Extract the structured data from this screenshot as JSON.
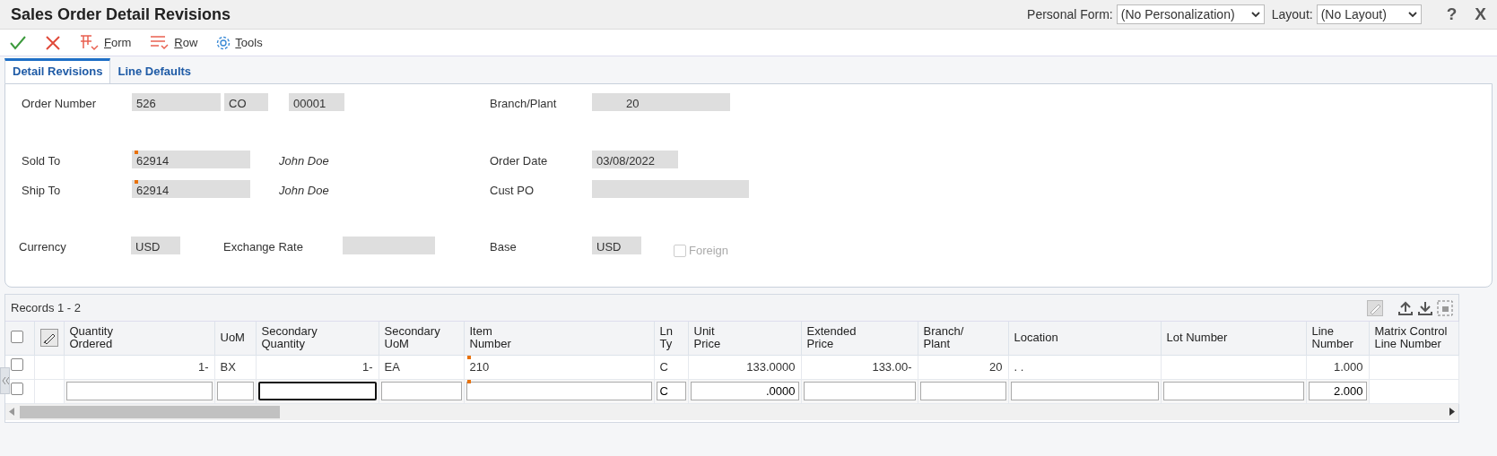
{
  "window": {
    "title": "Sales Order Detail Revisions"
  },
  "header_controls": {
    "personal_form": {
      "label": "Personal Form:",
      "value": "(No Personalization)"
    },
    "layout": {
      "label": "Layout:",
      "value": "(No Layout)"
    },
    "help": "?",
    "close": "X"
  },
  "toolbar": [
    {
      "kind": "ok"
    },
    {
      "kind": "cancel"
    },
    {
      "kind": "form",
      "label": "Form"
    },
    {
      "kind": "row",
      "label": "Row"
    },
    {
      "kind": "tools",
      "label": "Tools"
    }
  ],
  "tabs": [
    {
      "label": "Detail Revisions",
      "selected": true
    },
    {
      "label": "Line Defaults",
      "selected": false
    }
  ],
  "form": {
    "fields": [
      {
        "kind": "field",
        "label": "Order Number",
        "values": [
          "526",
          "CO",
          "00001"
        ]
      },
      {
        "kind": "field",
        "label": "Branch/Plant",
        "values": [
          "20"
        ]
      },
      {
        "kind": "field",
        "label": "Sold To",
        "values": [
          "62914"
        ],
        "required": true,
        "name": "John Doe"
      },
      {
        "kind": "field",
        "label": "Order Date",
        "values": [
          "03/08/2022"
        ]
      },
      {
        "kind": "field",
        "label": "Ship To",
        "values": [
          "62914"
        ],
        "required": true,
        "name": "John Doe"
      },
      {
        "kind": "field",
        "label": "Cust PO"
      },
      {
        "kind": "field",
        "label": "Currency",
        "values": [
          "USD"
        ]
      },
      {
        "kind": "field",
        "label": "Exchange Rate"
      },
      {
        "kind": "field",
        "label": "Base",
        "values": [
          "USD"
        ]
      },
      {
        "kind": "checkbox",
        "label": "Foreign",
        "checked": false,
        "disabled": true
      }
    ]
  },
  "grid": {
    "records": "Records 1 - 2",
    "select_all_checked": false,
    "columns": [
      "Quantity Ordered",
      "UoM",
      "Secondary Quantity",
      "Secondary UoM",
      "Item Number",
      "Ln Ty",
      "Unit Price",
      "Extended Price",
      "Branch/ Plant",
      "Location",
      "Lot Number",
      "Line Number",
      "Matrix Control Line Number"
    ],
    "rows": [
      {
        "kind": "data",
        "checked": false,
        "cells": [
          {
            "text": "1-"
          },
          {
            "text": "BX"
          },
          {
            "text": "1-"
          },
          {
            "text": "EA"
          },
          {
            "text": "210",
            "required": true
          },
          {
            "text": "C"
          },
          {
            "text": "133.0000"
          },
          {
            "text": "133.00-"
          },
          {
            "text": "20"
          },
          {
            "text": ".  ."
          },
          {},
          {
            "text": "1.000"
          },
          {}
        ]
      },
      {
        "kind": "entry",
        "checked": false,
        "cells": [
          {},
          {},
          {
            "focused": true
          },
          {},
          {
            "required": true
          },
          {
            "text": "C"
          },
          {
            "text": ".0000"
          },
          {},
          {},
          {},
          {},
          {
            "text": "2.000"
          },
          {
            "kind": "none"
          }
        ]
      }
    ]
  }
}
